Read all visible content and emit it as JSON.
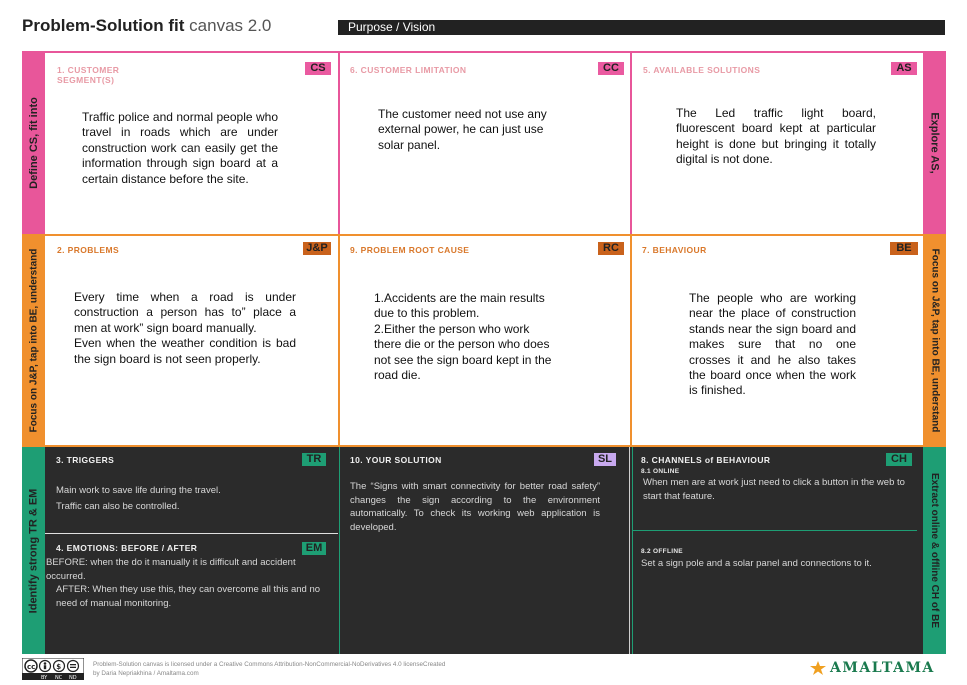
{
  "header": {
    "title_bold": "Problem-Solution fit",
    "title_light": "canvas 2.0",
    "purpose": "Purpose / Vision"
  },
  "bands": {
    "left_top": "Define CS, fit into",
    "left_mid": "Focus on J&P, tap into BE, understand",
    "left_bottom": "Identify strong TR & EM",
    "right_top": "Explore AS,",
    "right_mid": "Focus on J&P, tap into BE, understand",
    "right_bottom": "Extract online & offline CH of BE"
  },
  "blocks": {
    "cs": {
      "label_line1": "1. CUSTOMER",
      "label_line2": "SEGMENT(S)",
      "tag": "CS",
      "text": "Traffic police and normal people who travel in roads which are under construction work can easily get the information through sign board at a certain distance before the site."
    },
    "cc": {
      "label": "6. CUSTOMER LIMITATION",
      "tag": "CC",
      "text": "The customer need not use any external power, he can just use solar panel."
    },
    "as": {
      "label": "5. AVAILABLE SOLUTIONS",
      "tag": "AS",
      "text": "The Led traffic light board, fluorescent board kept at particular height is done but bringing it totally digital is not done."
    },
    "jp": {
      "label": "2.  PROBLEMS",
      "tag": "J&P",
      "text1": "Every time when a road is under construction a person has to” place a men at work” sign board manually.",
      "text2": "Even when the weather condition is bad the sign board is not seen properly."
    },
    "rc": {
      "label": "9. PROBLEM ROOT CAUSE",
      "tag": "RC",
      "text1": "1.Accidents are the main results due to this problem.",
      "text2": "2.Either the person who work there die or the person who does not see the sign board kept in the road die."
    },
    "be": {
      "label": "7. BEHAVIOUR",
      "tag": "BE",
      "text": "The people who are working near the place of construction stands near the sign board and makes sure that no one crosses it and he also takes the board once when the work is finished."
    },
    "tr": {
      "label": "3. TRIGGERS",
      "tag": "TR",
      "text1": "Main work to save life during the travel.",
      "text2": "Traffic can also be controlled."
    },
    "em": {
      "label": "4. EMOTIONS: BEFORE / AFTER",
      "tag": "EM",
      "text1": "BEFORE: when the do it manually it is difficult and accident occurred.",
      "text2": "AFTER: When they use this, they can overcome all this and no need of manual monitoring."
    },
    "sl": {
      "label": "10. YOUR SOLUTION",
      "tag": "SL",
      "text": "The “Signs with smart connectivity for better road safety” changes the sign according to the environment automatically. To check its working web application is developed."
    },
    "ch": {
      "label": "8. CHANNELS of BEHAVIOUR",
      "tag": "CH",
      "sub1": "8.1 ONLINE",
      "text1": "When men are at work just need to click a button in the web to start that feature.",
      "sub2": "8.2 OFFLINE",
      "text2": "Set a sign pole and a solar panel and connections to it."
    }
  },
  "footer": {
    "license": "Problem-Solution canvas is licensed under a Creative Commons Attribution-NonCommercial-NoDerivatives 4.0 licenseCreated",
    "author": "by Daria Nepriakhina / Amaltama.com",
    "logo": "AMALTAMA",
    "cc_badges": [
      "BY",
      "NC",
      "ND"
    ]
  },
  "colors": {
    "pink": "#e8569a",
    "orange": "#f0902e",
    "green": "#1e9e74",
    "dark": "#2b2b2b"
  }
}
